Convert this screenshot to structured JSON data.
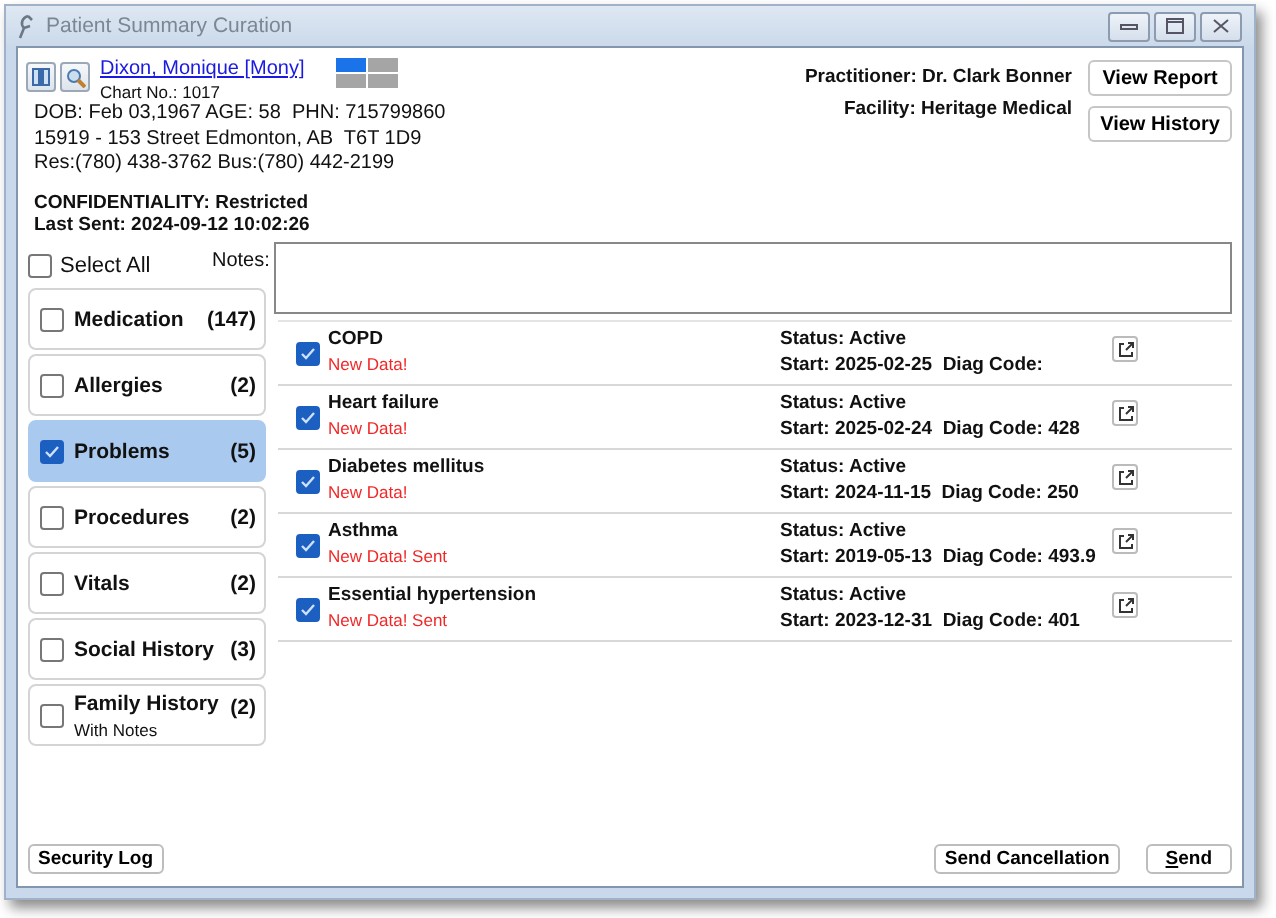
{
  "window": {
    "title": "Patient Summary Curation"
  },
  "patient": {
    "name": "Dixon, Monique [Mony]",
    "chart_no": "Chart No.: 1017",
    "details": [
      "DOB: Feb 03,1967 AGE: 58  PHN: 715799860",
      "15919 - 153 Street Edmonton, AB  T6T 1D9",
      "Res:(780) 438-3762 Bus:(780) 442-2199"
    ],
    "confidentiality": "CONFIDENTIALITY: Restricted",
    "last_sent": "Last Sent: 2024-09-12 10:02:26"
  },
  "practitioner": "Practitioner: Dr. Clark Bonner",
  "facility": "Facility: Heritage Medical",
  "header_buttons": [
    "View Report",
    "View History"
  ],
  "select_all": {
    "label": "Select All",
    "checked": false
  },
  "notes": {
    "label": "Notes:"
  },
  "categories": [
    {
      "label": "Medication",
      "count": "(147)",
      "checked": false,
      "selected": false
    },
    {
      "label": "Allergies",
      "count": "(2)",
      "checked": false,
      "selected": false
    },
    {
      "label": "Problems",
      "count": "(5)",
      "checked": true,
      "selected": true
    },
    {
      "label": "Procedures",
      "count": "(2)",
      "checked": false,
      "selected": false
    },
    {
      "label": "Vitals",
      "count": "(2)",
      "checked": false,
      "selected": false
    },
    {
      "label": "Social History",
      "count": "(3)",
      "checked": false,
      "selected": false
    },
    {
      "label": "Family History",
      "count": "(2)",
      "note": "With Notes",
      "checked": false,
      "selected": false
    }
  ],
  "problems": [
    {
      "name": "COPD",
      "flag": "New Data!",
      "checked": true,
      "status": "Status: Active",
      "start": "Start: 2025-02-25  Diag Code:"
    },
    {
      "name": "Heart failure",
      "flag": "New Data!",
      "checked": true,
      "status": "Status: Active",
      "start": "Start: 2025-02-24  Diag Code: 428"
    },
    {
      "name": "Diabetes mellitus",
      "flag": "New Data!",
      "checked": true,
      "status": "Status: Active",
      "start": "Start: 2024-11-15  Diag Code: 250"
    },
    {
      "name": "Asthma",
      "flag": "New Data! Sent",
      "checked": true,
      "status": "Status: Active",
      "start": "Start: 2019-05-13  Diag Code: 493.9"
    },
    {
      "name": "Essential hypertension",
      "flag": "New Data! Sent",
      "checked": true,
      "status": "Status: Active",
      "start": "Start: 2023-12-31  Diag Code: 401"
    }
  ],
  "footer_buttons": [
    {
      "label": "Security Log",
      "kind": "plain"
    },
    {
      "label": "Send Cancellation",
      "kind": "plain"
    },
    {
      "label": "Send",
      "kind": "default"
    }
  ]
}
